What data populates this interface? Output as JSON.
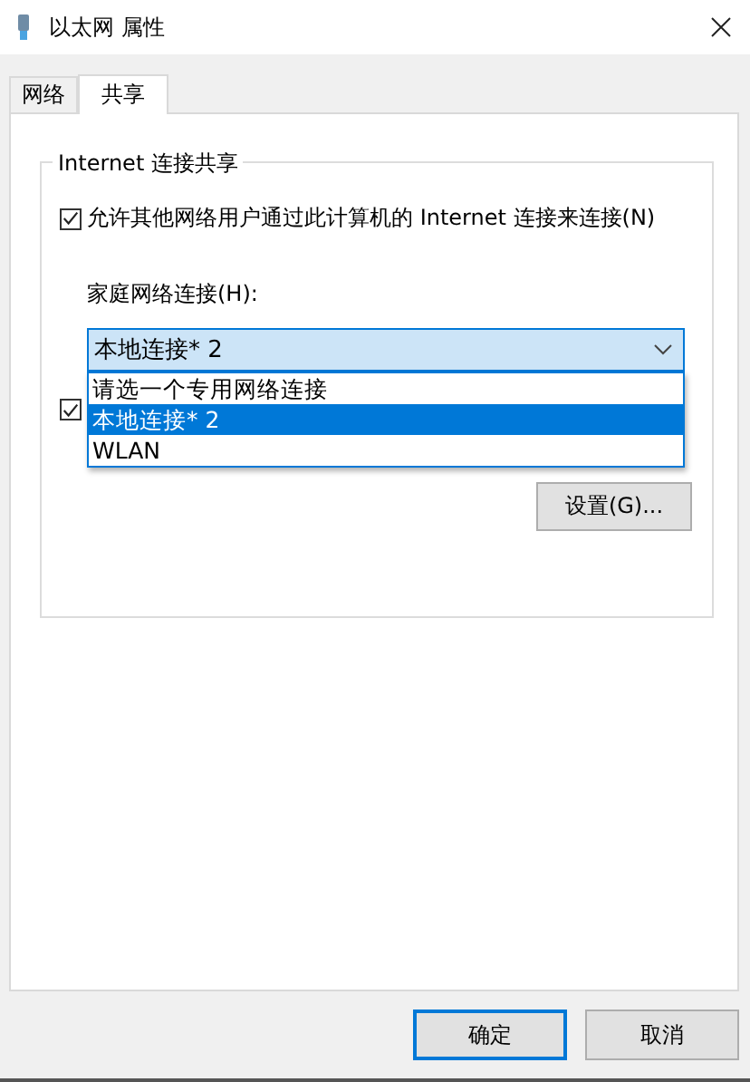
{
  "window": {
    "title": "以太网 属性"
  },
  "tabs": [
    {
      "label": "网络",
      "selected": false
    },
    {
      "label": "共享",
      "selected": true
    }
  ],
  "group": {
    "title": "Internet 连接共享",
    "allow_sharing": {
      "label": "允许其他网络用户通过此计算机的 Internet 连接来连接(N)",
      "checked": true
    },
    "home_connection": {
      "label": "家庭网络连接(H):",
      "value": "本地连接* 2",
      "options": [
        {
          "label": "请选一个专用网络连接",
          "selected": false
        },
        {
          "label": "本地连接* 2",
          "selected": true
        },
        {
          "label": "WLAN",
          "selected": false
        }
      ]
    },
    "second_checkbox": {
      "checked": true
    },
    "settings_button": "设置(G)..."
  },
  "buttons": [
    {
      "label": "确定",
      "default": true
    },
    {
      "label": "取消",
      "default": false
    }
  ]
}
